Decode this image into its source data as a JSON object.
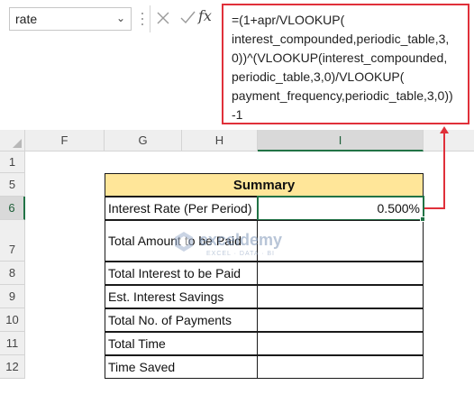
{
  "name_box": {
    "value": "rate"
  },
  "formula_bar": {
    "lines": [
      "=(1+apr/VLOOKUP(",
      "interest_compounded,periodic_table,3,",
      "0))^(VLOOKUP(interest_compounded,",
      "periodic_table,3,0)/VLOOKUP(",
      "payment_frequency,periodic_table,3,0))",
      "-1"
    ]
  },
  "columns": [
    "F",
    "G",
    "H",
    "I"
  ],
  "selected_column": "I",
  "rows": [
    "1",
    "5",
    "6",
    "7",
    "8",
    "9",
    "10",
    "11",
    "12"
  ],
  "selected_row": "6",
  "summary": {
    "header": "Summary",
    "rows": [
      {
        "label": "Interest Rate (Per Period)",
        "value": "0.500%"
      },
      {
        "label": "Total Amount to be Paid",
        "value": ""
      },
      {
        "label": "Total Interest to be Paid",
        "value": ""
      },
      {
        "label": "Est. Interest Savings",
        "value": ""
      },
      {
        "label": "Total No. of Payments",
        "value": ""
      },
      {
        "label": "Total Time",
        "value": ""
      },
      {
        "label": "Time Saved",
        "value": ""
      }
    ]
  },
  "watermark": {
    "name": "exceldemy",
    "tagline": "EXCEL · DATA · BI"
  },
  "colors": {
    "accent_red": "#e0303a",
    "header_fill": "#ffe699",
    "selection_green": "#217346"
  }
}
